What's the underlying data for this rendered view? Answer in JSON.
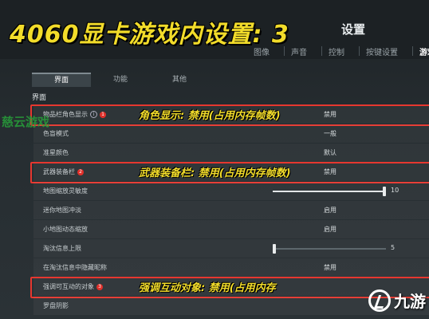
{
  "header": {
    "big_title": "4060显卡游戏内设置: 3",
    "settings_title": "设置",
    "tabs": [
      {
        "label": "图像"
      },
      {
        "label": "声音"
      },
      {
        "label": "控制"
      },
      {
        "label": "按键设置"
      },
      {
        "label": "游戏",
        "active": true
      }
    ]
  },
  "subtabs": [
    {
      "label": "界面",
      "active": true
    },
    {
      "label": "功能"
    },
    {
      "label": "其他"
    }
  ],
  "section_label": "界面",
  "watermark_left": "慈云游戏",
  "rows": [
    {
      "label": "物品栏角色显示",
      "value": "禁用",
      "badge": "1",
      "info": true,
      "annotation": "角色显示: 禁用(占用内存帧数)",
      "highlighted": true
    },
    {
      "label": "色盲模式",
      "value": "一般"
    },
    {
      "label": "准星颜色",
      "value": "默认"
    },
    {
      "label": "武器装备栏",
      "value": "禁用",
      "badge": "2",
      "annotation": "武器装备栏: 禁用(占用内存帧数)",
      "highlighted": true
    },
    {
      "label": "地图缩放灵敏度",
      "slider": {
        "value": 10,
        "min": 0,
        "max": 10
      }
    },
    {
      "label": "迷你地图冲淡",
      "value": "启用"
    },
    {
      "label": "小地图动态缩放",
      "value": "启用"
    },
    {
      "label": "淘汰信息上限",
      "slider": {
        "value": 0,
        "min": 0,
        "max": 5
      },
      "slider_label": "5"
    },
    {
      "label": "在淘汰信息中隐藏昵称",
      "value": "禁用"
    },
    {
      "label": "强调可互动的对象",
      "value": "",
      "badge": "3",
      "annotation": "强调互动对象: 禁用(占用内存",
      "highlighted": true
    },
    {
      "label": "罗盘阴影",
      "checkbox": true
    }
  ],
  "logo": {
    "text": "九游"
  },
  "colors": {
    "annotation": "#f2dc2a",
    "frame": "#e6372f",
    "badge": "#e0302a",
    "watermark": "#27a03a"
  }
}
